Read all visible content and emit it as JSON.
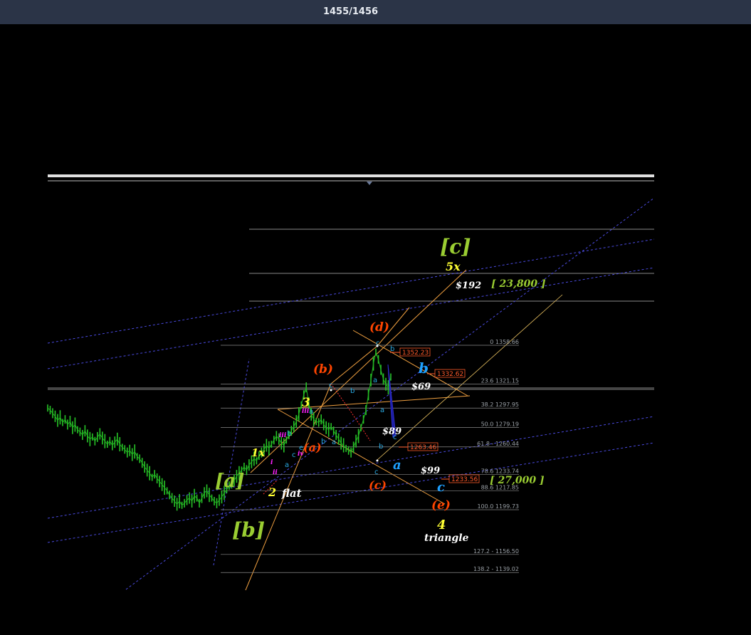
{
  "header": {
    "counter": "1455/1456"
  },
  "colors": {
    "background": "#000000",
    "topbar": "#2b3447",
    "price": "#27c427",
    "green_label": "#9acd32",
    "yellow_label": "#ffff33",
    "orange_label": "#ff4500",
    "cyan_label": "#1ea0ff",
    "magenta_label": "#ff00ff",
    "white_label": "#ffffff",
    "channel_dashed": "#4a4adf",
    "fib_line": "#9a9a9a"
  },
  "chart_data": {
    "type": "line",
    "title": "",
    "fib_levels": [
      {
        "ratio": "0",
        "price": "1358.66",
        "label": "0 1358.66"
      },
      {
        "ratio": "23.6",
        "price": "1321.15",
        "label": "23.6 1321.15"
      },
      {
        "ratio": "38.2",
        "price": "1297.95",
        "label": "38.2 1297.95"
      },
      {
        "ratio": "50.0",
        "price": "1279.19",
        "label": "50.0 1279.19"
      },
      {
        "ratio": "61.8",
        "price": "1260.44",
        "label": "61.8 - 1260.44"
      },
      {
        "ratio": "78.6",
        "price": "1233.74",
        "label": "78.6 1233.74"
      },
      {
        "ratio": "88.6",
        "price": "1217.85",
        "label": "88.6 1217.85"
      },
      {
        "ratio": "100.0",
        "price": "1199.73",
        "label": "100.0 1199.73"
      },
      {
        "ratio": "127.2",
        "price": "1156.50",
        "label": "127.2 - 1156.50"
      },
      {
        "ratio": "138.2",
        "price": "1139.02",
        "label": "138.2 - 1139.02"
      }
    ],
    "price_boxes": [
      "1352.23",
      "1332.62",
      "1263.46",
      "1233.56"
    ],
    "wave_labels": {
      "green": [
        "[a]",
        "[b]",
        "[c]"
      ],
      "yellow": [
        "1x",
        "2",
        "3",
        "4",
        "5x"
      ],
      "orange": [
        "(a)",
        "(b)",
        "(c)",
        "(d)",
        "(e)"
      ],
      "cyan": [
        "b",
        "a",
        "c"
      ],
      "white": [
        "flat",
        "triangle",
        "$192",
        "$69",
        "$89",
        "$99"
      ],
      "targets": [
        "[ 23,800 ]",
        "[ 27,000 ]"
      ],
      "small_cyan": [
        "a",
        "b",
        "c",
        "a",
        "b",
        "c",
        "a",
        "b",
        "c",
        "a",
        "b",
        "c",
        "e"
      ],
      "small_magenta": [
        "i",
        "ii",
        "iii",
        "iv",
        "ii",
        "iii"
      ]
    },
    "price_series": [
      1298,
      1296,
      1293,
      1290,
      1286,
      1289,
      1284,
      1287,
      1282,
      1285,
      1279,
      1282,
      1277,
      1275,
      1272,
      1276,
      1271,
      1268,
      1270,
      1266,
      1270,
      1273,
      1269,
      1266,
      1263,
      1266,
      1262,
      1265,
      1268,
      1263,
      1260,
      1258,
      1255,
      1257,
      1253,
      1256,
      1251,
      1249,
      1245,
      1241,
      1238,
      1235,
      1231,
      1234,
      1230,
      1227,
      1224,
      1221,
      1218,
      1214,
      1211,
      1208,
      1205,
      1208,
      1204,
      1206,
      1209,
      1211,
      1208,
      1213,
      1211,
      1206,
      1211,
      1216,
      1218,
      1214,
      1211,
      1208,
      1206,
      1209,
      1212,
      1216,
      1219,
      1223,
      1225,
      1228,
      1232,
      1235,
      1238,
      1241,
      1238,
      1243,
      1246,
      1249,
      1247,
      1252,
      1255,
      1258,
      1262,
      1259,
      1263,
      1267,
      1271,
      1268,
      1264,
      1262,
      1267,
      1272,
      1276,
      1280,
      1285,
      1292,
      1301,
      1311,
      1318,
      1303,
      1292,
      1287,
      1285,
      1284,
      1287,
      1282,
      1279,
      1277,
      1280,
      1276,
      1272,
      1268,
      1264,
      1262,
      1259,
      1257,
      1255,
      1260,
      1266,
      1271,
      1279,
      1287,
      1296,
      1311,
      1325,
      1341,
      1352,
      1345,
      1335,
      1326,
      1321,
      1318,
      1328
    ]
  }
}
